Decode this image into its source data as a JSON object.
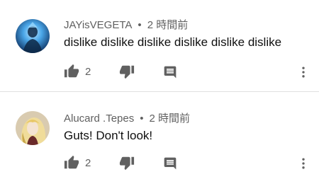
{
  "comments": [
    {
      "author": "JAYisVEGETA",
      "separator": "•",
      "time": "2 時間前",
      "text": "dislike dislike dislike dislike dislike dislike",
      "likes": "2",
      "avatar_icon": "blue-glow-character-avatar"
    },
    {
      "author": "Alucard .Tepes",
      "separator": "•",
      "time": "2 時間前",
      "text": "Guts! Don't look!",
      "likes": "2",
      "avatar_icon": "blonde-character-avatar"
    }
  ],
  "icons": {
    "like": "thumb-up-icon",
    "dislike": "thumb-down-icon",
    "reply": "comment-reply-icon",
    "more": "more-vertical-icon"
  },
  "colors": {
    "icon": "#606060",
    "meta_text": "#606060",
    "body_text": "#0f0f0f",
    "divider": "#e0e0e0"
  }
}
